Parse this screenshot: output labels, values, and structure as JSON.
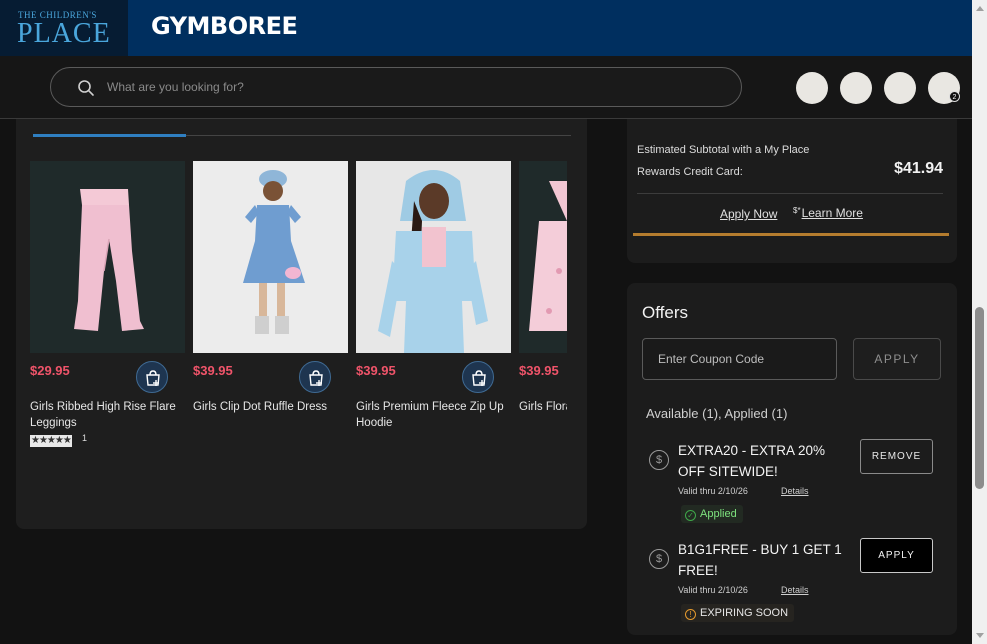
{
  "brands": {
    "tcp_small": "THE CHILDREN'S",
    "tcp_big": "PLACE",
    "gymboree": "GYMBOREE"
  },
  "search": {
    "placeholder": "What are you looking for?"
  },
  "header": {
    "cart_count": "2"
  },
  "products": [
    {
      "price": "$29.95",
      "name": "Girls Ribbed High Rise Flare Leggings",
      "stars": "★★★★★",
      "rating_count": "1"
    },
    {
      "price": "$39.95",
      "name": "Girls Clip Dot Ruffle Dress"
    },
    {
      "price": "$39.95",
      "name": "Girls Premium Fleece Zip Up Hoodie"
    },
    {
      "price": "$39.95",
      "name": "Girls Floral Print Dress"
    }
  ],
  "summary": {
    "estimated_label": "Estimated Subtotal with a My Place Rewards Credit Card:",
    "estimated_price": "$41.94",
    "apply_now": "Apply Now",
    "learn_more_sup": "$*",
    "learn_more": "Learn More"
  },
  "offers": {
    "title": "Offers",
    "coupon_placeholder": "Enter Coupon Code",
    "apply_label": "APPLY",
    "availability": "Available (1),  Applied (1)",
    "items": [
      {
        "title": "EXTRA20 - EXTRA 20% OFF SITEWIDE!",
        "valid": "Valid thru 2/10/26",
        "details": "Details",
        "button": "REMOVE",
        "status": "Applied"
      },
      {
        "title": "B1G1FREE - BUY 1 GET 1 FREE!",
        "valid": "Valid thru 2/10/26",
        "details": "Details",
        "button": "APPLY",
        "status": "EXPIRING SOON"
      }
    ]
  },
  "colors": {
    "price": "#f0546a",
    "brand_bar": "#002f5f",
    "accent_blue": "#2f7fc1",
    "gold": "#b47c2e",
    "applied_green": "#7ee27e"
  }
}
